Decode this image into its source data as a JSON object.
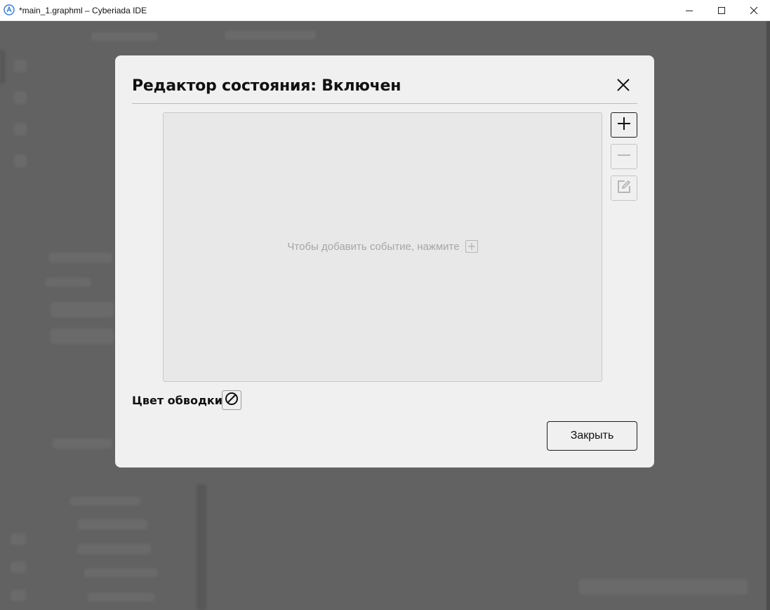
{
  "window": {
    "title": "*main_1.graphml – Cyberiada IDE",
    "app_icon": "cyberiada-logo-icon",
    "controls": [
      "minimize-icon",
      "maximize-icon",
      "close-icon"
    ]
  },
  "modal": {
    "title": "Редактор состояния: Включен",
    "close_icon": "close-icon",
    "events": {
      "empty_hint": "Чтобы добавить событие, нажмите",
      "hint_icon": "plus-icon",
      "items": []
    },
    "actions": {
      "add": {
        "icon": "plus-icon",
        "enabled": true
      },
      "remove": {
        "icon": "minus-icon",
        "enabled": false
      },
      "edit": {
        "icon": "edit-icon",
        "enabled": false
      }
    },
    "outline_color": {
      "label": "Цвет обводки:",
      "icon": "no-color-icon"
    },
    "close_button_label": "Закрыть"
  },
  "colors": {
    "overlay": "#626262",
    "modal_bg": "#f0f0f0",
    "panel_bg": "#e8e8e8",
    "hint_text": "#a6a6a6"
  }
}
